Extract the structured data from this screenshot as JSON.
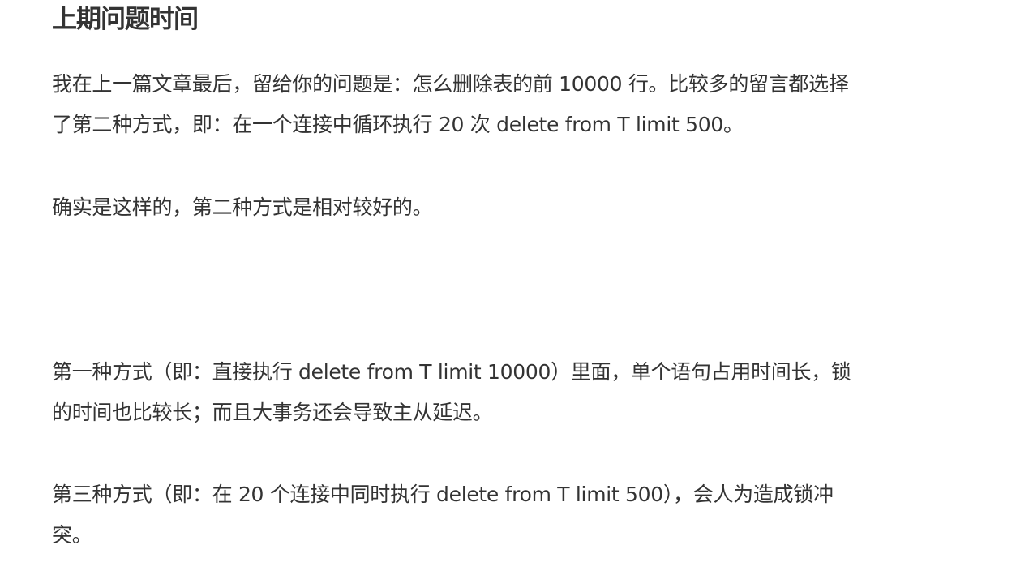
{
  "heading": "上期问题时间",
  "paragraphs": [
    {
      "lines": [
        "我在上一篇文章最后，留给你的问题是：怎么删除表的前 10000 行。比较多的留言都选择",
        "了第二种方式，即：在一个连接中循环执行 20 次 delete from T limit 500。"
      ]
    },
    {
      "lines": [
        "确实是这样的，第二种方式是相对较好的。"
      ]
    },
    {
      "lines": [
        "第一种方式（即：直接执行 delete from T limit 10000）里面，单个语句占用时间长，锁",
        "的时间也比较长；而且大事务还会导致主从延迟。"
      ]
    },
    {
      "lines": [
        "第三种方式（即：在 20 个连接中同时执行 delete from T limit 500），会人为造成锁冲",
        "突。"
      ]
    }
  ]
}
